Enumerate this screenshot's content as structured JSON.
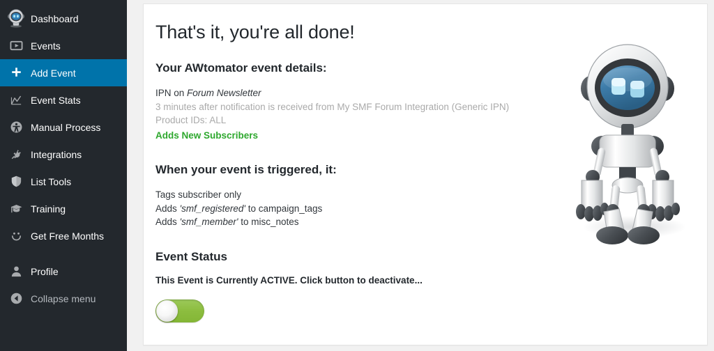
{
  "sidebar": {
    "items": [
      {
        "label": "Dashboard",
        "icon": "robot-icon",
        "active": false,
        "dim": false
      },
      {
        "label": "Events",
        "icon": "play-icon",
        "active": false,
        "dim": false
      },
      {
        "label": "Add Event",
        "icon": "plus-icon",
        "active": true,
        "dim": false
      },
      {
        "label": "Event Stats",
        "icon": "chart-line-icon",
        "active": false,
        "dim": false
      },
      {
        "label": "Manual Process",
        "icon": "accessibility-icon",
        "active": false,
        "dim": false
      },
      {
        "label": "Integrations",
        "icon": "plug-icon",
        "active": false,
        "dim": false
      },
      {
        "label": "List Tools",
        "icon": "shield-icon",
        "active": false,
        "dim": false
      },
      {
        "label": "Training",
        "icon": "graduation-cap-icon",
        "active": false,
        "dim": false
      },
      {
        "label": "Get Free Months",
        "icon": "smiley-icon",
        "active": false,
        "dim": false
      },
      {
        "label": "Profile",
        "icon": "person-icon",
        "active": false,
        "dim": false
      },
      {
        "label": "Collapse menu",
        "icon": "collapse-arrow-icon",
        "active": false,
        "dim": true
      }
    ],
    "active_color": "#0073aa",
    "background_color": "#23282d"
  },
  "main": {
    "page_title": "That's it, you're all done!",
    "details": {
      "heading": "Your AWtomator event details:",
      "line1_prefix": "IPN on ",
      "line1_emphasis": "Forum Newsletter",
      "line2": "3 minutes after notification is received from My SMF Forum Integration (Generic IPN)",
      "line3": "Product IDs: ALL",
      "line4": "Adds New Subscribers",
      "line4_color": "#2ea82e"
    },
    "trigger": {
      "heading": "When your event is triggered, it:",
      "line1": "Tags subscriber only",
      "line2_prefix": "Adds ",
      "line2_emphasis": "'smf_registered'",
      "line2_suffix": " to campaign_tags",
      "line3_prefix": "Adds ",
      "line3_emphasis": "'smf_member'",
      "line3_suffix": " to misc_notes"
    },
    "status": {
      "heading": "Event Status",
      "text": "This Event is Currently ACTIVE. Click button to deactivate...",
      "toggle_state": "on",
      "toggle_color": "#8cbd3f"
    },
    "mascot": "robot-mascot-illustration"
  }
}
